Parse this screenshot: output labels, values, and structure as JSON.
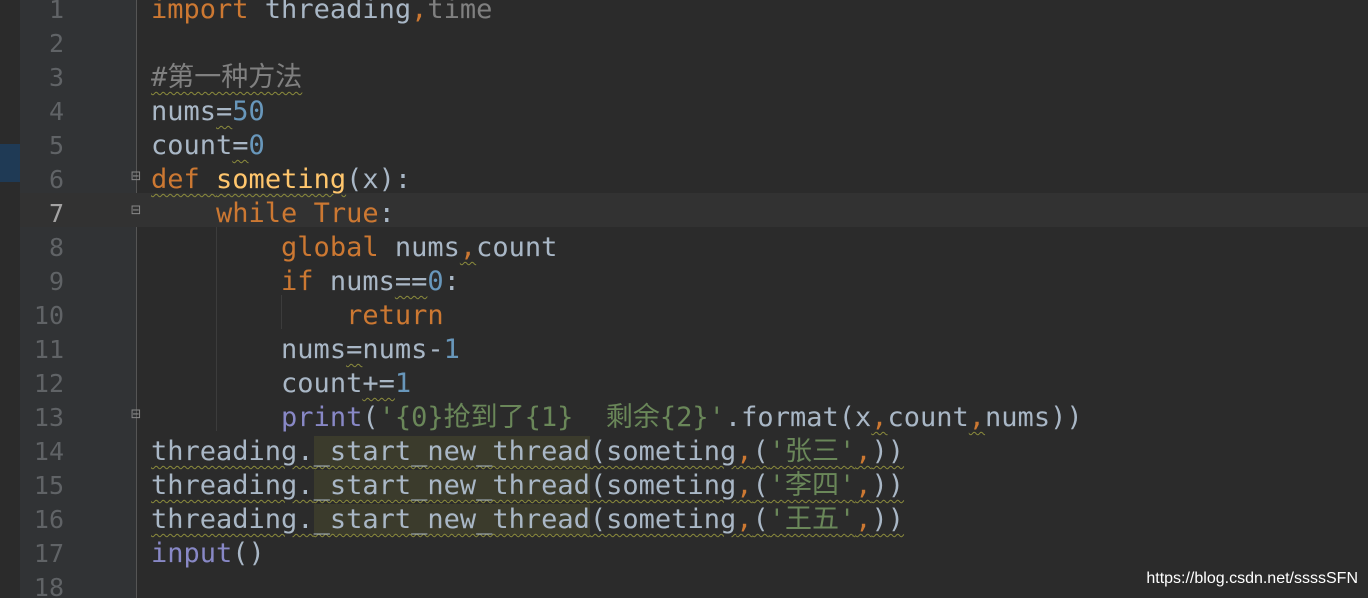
{
  "editor": {
    "line_numbers": [
      "1",
      "2",
      "3",
      "4",
      "5",
      "6",
      "7",
      "8",
      "9",
      "10",
      "11",
      "12",
      "13",
      "14",
      "15",
      "16",
      "17",
      "18"
    ],
    "current_line_index": 6,
    "lines": [
      [
        {
          "t": "import",
          "c": "kw"
        },
        {
          "t": " threading",
          "c": "op"
        },
        {
          "t": ",",
          "c": "kw"
        },
        {
          "t": "time",
          "c": "cmt"
        }
      ],
      [],
      [
        {
          "t": "#第一种方法",
          "c": "cmt",
          "squig": true
        }
      ],
      [
        {
          "t": "nums",
          "c": "op"
        },
        {
          "t": "=",
          "c": "op",
          "squig": true
        },
        {
          "t": "50",
          "c": "num"
        }
      ],
      [
        {
          "t": "count",
          "c": "op"
        },
        {
          "t": "=",
          "c": "op",
          "squig": true
        },
        {
          "t": "0",
          "c": "num"
        }
      ],
      [
        {
          "t": "def",
          "c": "kw",
          "squig": true
        },
        {
          "t": " ",
          "c": "op",
          "squig": true
        },
        {
          "t": "someting",
          "c": "fn",
          "squig": true
        },
        {
          "t": "(x):",
          "c": "op"
        }
      ],
      [
        {
          "t": "    ",
          "c": "op"
        },
        {
          "t": "while",
          "c": "kw"
        },
        {
          "t": " ",
          "c": "op"
        },
        {
          "t": "True",
          "c": "kw"
        },
        {
          "t": ":",
          "c": "op"
        }
      ],
      [
        {
          "t": "        ",
          "c": "op"
        },
        {
          "t": "global",
          "c": "kw"
        },
        {
          "t": " nums",
          "c": "op"
        },
        {
          "t": ",",
          "c": "kw",
          "squig": true
        },
        {
          "t": "count",
          "c": "op"
        }
      ],
      [
        {
          "t": "        ",
          "c": "op"
        },
        {
          "t": "if",
          "c": "kw"
        },
        {
          "t": " nums",
          "c": "op"
        },
        {
          "t": "==",
          "c": "op",
          "squig": true
        },
        {
          "t": "0",
          "c": "num"
        },
        {
          "t": ":",
          "c": "op"
        }
      ],
      [
        {
          "t": "            ",
          "c": "op"
        },
        {
          "t": "return",
          "c": "kw"
        }
      ],
      [
        {
          "t": "        ",
          "c": "op"
        },
        {
          "t": "nums",
          "c": "op"
        },
        {
          "t": "=",
          "c": "op",
          "squig": true
        },
        {
          "t": "nums",
          "c": "op"
        },
        {
          "t": "-",
          "c": "op"
        },
        {
          "t": "1",
          "c": "num"
        }
      ],
      [
        {
          "t": "        ",
          "c": "op"
        },
        {
          "t": "count",
          "c": "op"
        },
        {
          "t": "+=",
          "c": "op",
          "squig": true
        },
        {
          "t": "1",
          "c": "num"
        }
      ],
      [
        {
          "t": "        ",
          "c": "op"
        },
        {
          "t": "print",
          "c": "bi"
        },
        {
          "t": "(",
          "c": "op"
        },
        {
          "t": "'{0}抢到了{1}  剩余{2}'",
          "c": "str"
        },
        {
          "t": ".format(x",
          "c": "op"
        },
        {
          "t": ",",
          "c": "kw",
          "squig": true
        },
        {
          "t": "count",
          "c": "op"
        },
        {
          "t": ",",
          "c": "kw",
          "squig": true
        },
        {
          "t": "nums))",
          "c": "op"
        }
      ],
      [
        {
          "t": "threading.",
          "c": "op",
          "squig": true
        },
        {
          "t": "_start_new_thread",
          "c": "op",
          "hl": true,
          "squig": true
        },
        {
          "t": "(someting",
          "c": "op",
          "squig": true
        },
        {
          "t": ",",
          "c": "kw",
          "squig": true
        },
        {
          "t": "(",
          "c": "op",
          "squig": true
        },
        {
          "t": "'张三'",
          "c": "str",
          "squig": true
        },
        {
          "t": ",",
          "c": "kw",
          "squig": true
        },
        {
          "t": "))",
          "c": "op",
          "squig": true
        }
      ],
      [
        {
          "t": "threading.",
          "c": "op",
          "squig": true
        },
        {
          "t": "_start_new_thread",
          "c": "op",
          "hl": true,
          "squig": true
        },
        {
          "t": "(someting",
          "c": "op",
          "squig": true
        },
        {
          "t": ",",
          "c": "kw",
          "squig": true
        },
        {
          "t": "(",
          "c": "op",
          "squig": true
        },
        {
          "t": "'李四'",
          "c": "str",
          "squig": true
        },
        {
          "t": ",",
          "c": "kw",
          "squig": true
        },
        {
          "t": "))",
          "c": "op",
          "squig": true
        }
      ],
      [
        {
          "t": "threading.",
          "c": "op",
          "squig": true
        },
        {
          "t": "_start_new_thread",
          "c": "op",
          "hl": true,
          "squig": true
        },
        {
          "t": "(someting",
          "c": "op",
          "squig": true
        },
        {
          "t": ",",
          "c": "kw",
          "squig": true
        },
        {
          "t": "(",
          "c": "op",
          "squig": true
        },
        {
          "t": "'王五'",
          "c": "str",
          "squig": true
        },
        {
          "t": ",",
          "c": "kw",
          "squig": true
        },
        {
          "t": "))",
          "c": "op",
          "squig": true
        }
      ],
      [
        {
          "t": "input",
          "c": "bi"
        },
        {
          "t": "()",
          "c": "op"
        }
      ],
      []
    ]
  },
  "watermark": "https://blog.csdn.net/ssssSFN",
  "colors": {
    "background": "#2b2b2b",
    "gutter": "#313335",
    "keyword": "#cc7832",
    "function": "#ffc66d",
    "number": "#6897bb",
    "string": "#6a8759",
    "comment": "#808080",
    "builtin": "#8888c6",
    "text": "#a9b7c6"
  },
  "icons": {
    "fold_open": "fold-marker-icon",
    "fold_end": "fold-end-icon"
  }
}
